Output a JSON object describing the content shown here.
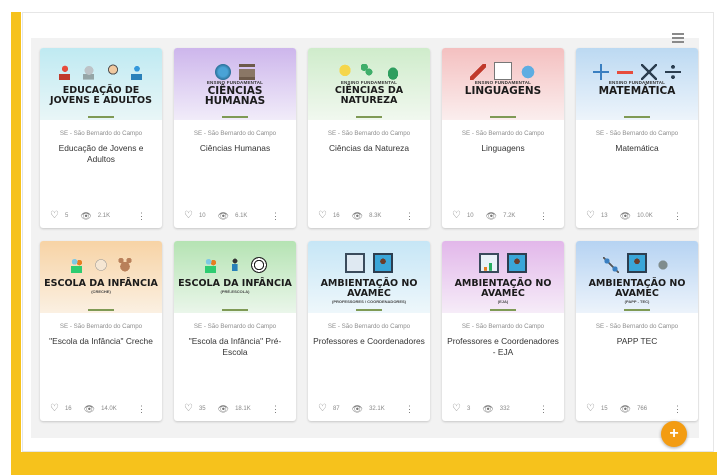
{
  "colors": {
    "accent": "#f6c21c",
    "fab": "#f39c12"
  },
  "toolbar": {
    "view_icon": "list-view-icon"
  },
  "fab": {
    "label": "+"
  },
  "cards": [
    {
      "banner_sub": "",
      "banner_title": "EDUCAÇÃO DE JOVENS E ADULTOS",
      "banner_small": "",
      "org": "SE - São Bernardo do Campo",
      "name": "Educação de Jovens e Adultos",
      "likes": "5",
      "views": "2.1K",
      "bg": "linear-gradient(180deg,#bfeaf2 0%,#e9f6f7 100%)",
      "icons": [
        "adult-student-icon",
        "robot-icon",
        "teacher-icon",
        "student-icon"
      ]
    },
    {
      "banner_sub": "ENSINO FUNDAMENTAL",
      "banner_title": "CIÊNCIAS HUMANAS",
      "banner_small": "",
      "org": "SE - São Bernardo do Campo",
      "name": "Ciências Humanas",
      "likes": "10",
      "views": "6.1K",
      "bg": "linear-gradient(180deg,#cdb6ec 0%,#f1ecf9 100%)",
      "icons": [
        "globe-icon",
        "museum-icon"
      ]
    },
    {
      "banner_sub": "ENSINO FUNDAMENTAL",
      "banner_title": "CIÊNCIAS DA NATUREZA",
      "banner_small": "",
      "org": "SE - São Bernardo do Campo",
      "name": "Ciências da Natureza",
      "likes": "16",
      "views": "8.3K",
      "bg": "linear-gradient(180deg,#cfeccb 0%,#f1f8ef 100%)",
      "icons": [
        "lightbulb-icon",
        "molecule-icon",
        "leaf-icon"
      ]
    },
    {
      "banner_sub": "ENSINO FUNDAMENTAL",
      "banner_title": "LINGUAGENS",
      "banner_small": "",
      "org": "SE - São Bernardo do Campo",
      "name": "Linguagens",
      "likes": "10",
      "views": "7.2K",
      "bg": "linear-gradient(180deg,#f4c0c0 0%,#fbeeee 100%)",
      "icons": [
        "pencil-icon",
        "book-icon",
        "speech-bubble-icon"
      ]
    },
    {
      "banner_sub": "ENSINO FUNDAMENTAL",
      "banner_title": "MATEMÁTICA",
      "banner_small": "",
      "org": "SE - São Bernardo do Campo",
      "name": "Matemática",
      "likes": "13",
      "views": "10.0K",
      "bg": "linear-gradient(180deg,#bcd9f2 0%,#edf4fb 100%)",
      "icons": [
        "plus-icon",
        "minus-icon",
        "times-icon",
        "divide-icon"
      ]
    },
    {
      "banner_sub": "",
      "banner_title": "ESCOLA DA INFÂNCIA",
      "banner_small": "(CRECHE)",
      "org": "SE - São Bernardo do Campo",
      "name": "\"Escola da Infância\" Creche",
      "likes": "16",
      "views": "14.0K",
      "bg": "linear-gradient(180deg,#f7d3a5 0%,#fbf0e2 100%)",
      "icons": [
        "children-icon",
        "baby-icon",
        "teddy-bear-icon"
      ]
    },
    {
      "banner_sub": "",
      "banner_title": "ESCOLA DA INFÂNCIA",
      "banner_small": "(PRÉ-ESCOLA)",
      "org": "SE - São Bernardo do Campo",
      "name": "\"Escola da Infância\" Pré-Escola",
      "likes": "35",
      "views": "18.1K",
      "bg": "linear-gradient(180deg,#b5e3b3 0%,#eaf6ea 100%)",
      "icons": [
        "children-icon",
        "kid-running-icon",
        "ball-icon"
      ]
    },
    {
      "banner_sub": "",
      "banner_title": "AMBIENTAÇÃO NO AVAMEC",
      "banner_small": "(PROFESSORES / COORDENADORES)",
      "org": "SE - São Bernardo do Campo",
      "name": "Professores e Coordenadores",
      "likes": "87",
      "views": "32.1K",
      "bg": "linear-gradient(180deg,#c6e6f6 0%,#eef7fb 100%)",
      "icons": [
        "monitor-icon",
        "teacher-screen-icon"
      ]
    },
    {
      "banner_sub": "",
      "banner_title": "AMBIENTAÇÃO NO AVAMEC",
      "banner_small": "(EJA)",
      "org": "SE - São Bernardo do Campo",
      "name": "Professores e Coordenadores - EJA",
      "likes": "3",
      "views": "332",
      "bg": "linear-gradient(180deg,#e2b7ea 0%,#f6ecf8 100%)",
      "icons": [
        "chart-screen-icon",
        "teacher-screen-icon"
      ]
    },
    {
      "banner_sub": "",
      "banner_title": "AMBIENTAÇÃO NO AVAMEC",
      "banner_small": "(PAPP - TEC)",
      "org": "SE - São Bernardo do Campo",
      "name": "PAPP TEC",
      "likes": "15",
      "views": "766",
      "bg": "linear-gradient(180deg,#b6d3f2 0%,#ecf3fb 100%)",
      "icons": [
        "network-icon",
        "teacher-screen-icon",
        "gears-icon"
      ]
    }
  ]
}
